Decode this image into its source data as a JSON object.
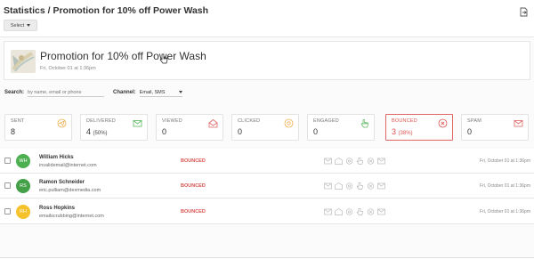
{
  "header": {
    "title": "Statistics / Promotion for 10% off Power Wash",
    "select_label": "Select"
  },
  "campaign": {
    "title": "Promotion for 10% off Power Wash",
    "date": "Fri, October 01 at 1:36pm"
  },
  "filters": {
    "search_label": "Search:",
    "search_placeholder": "by name, email or phone",
    "channel_label": "Channel:",
    "channel_value": "Email, SMS"
  },
  "stats": [
    {
      "label": "SENT",
      "value": "8",
      "pct": "",
      "icon": "paper-plane-icon",
      "color": "#f0ad4e"
    },
    {
      "label": "DELIVERED",
      "value": "4",
      "pct": "(50%)",
      "icon": "envelope-check-icon",
      "color": "#5cb85c"
    },
    {
      "label": "VIEWED",
      "value": "0",
      "pct": "",
      "icon": "open-envelope-icon",
      "color": "#e06666"
    },
    {
      "label": "CLICKED",
      "value": "0",
      "pct": "",
      "icon": "at-sign-icon",
      "color": "#f0ad4e"
    },
    {
      "label": "ENGAGED",
      "value": "0",
      "pct": "",
      "icon": "hand-pointer-icon",
      "color": "#5cb85c"
    },
    {
      "label": "BOUNCED",
      "value": "3",
      "pct": "(38%)",
      "icon": "x-circle-icon",
      "color": "#d9534f"
    },
    {
      "label": "SPAM",
      "value": "0",
      "pct": "",
      "icon": "envelope-x-icon",
      "color": "#e06666"
    }
  ],
  "recipients": [
    {
      "initials": "WH",
      "name": "William Hicks",
      "email": "invalidemail@internet.com",
      "status": "BOUNCED",
      "date": "Fri, October 01 at 1:36pm",
      "avatar_color": "#4caf50"
    },
    {
      "initials": "RS",
      "name": "Ramon Schneider",
      "email": "eric.pulliam@dexmedia.com",
      "status": "BOUNCED",
      "date": "Fri, October 01 at 1:36pm",
      "avatar_color": "#43a047"
    },
    {
      "initials": "RH",
      "name": "Ross Hopkins",
      "email": "emailscrubbing@internet.com",
      "status": "BOUNCED",
      "date": "Fri, October 01 at 1:36pm",
      "avatar_color": "#f5c22b"
    }
  ],
  "colors": {
    "bounced": "#d9534f"
  }
}
